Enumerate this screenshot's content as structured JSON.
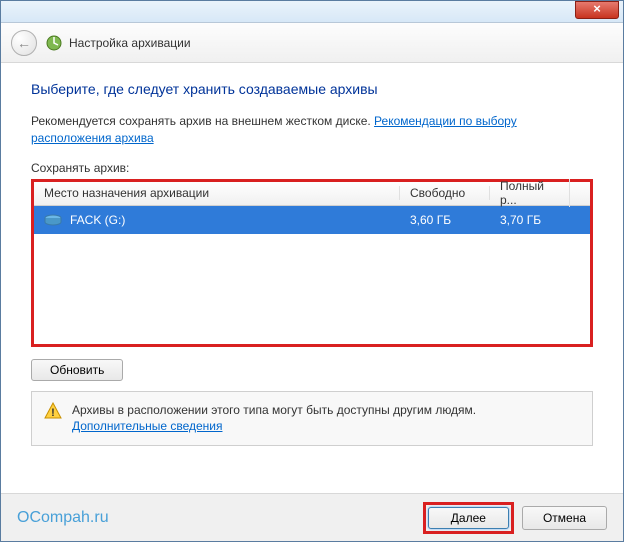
{
  "titlebar": {
    "close_glyph": "×"
  },
  "header": {
    "back_glyph": "←",
    "title": "Настройка архивации"
  },
  "content": {
    "heading": "Выберите, где следует хранить создаваемые архивы",
    "desc_prefix": "Рекомендуется сохранять архив на внешнем жестком диске. ",
    "desc_link": "Рекомендации по выбору расположения архива",
    "save_label": "Сохранять архив:",
    "columns": {
      "dest": "Место назначения архивации",
      "free": "Свободно",
      "total": "Полный р..."
    },
    "rows": [
      {
        "name": "FACK (G:)",
        "free": "3,60 ГБ",
        "total": "3,70 ГБ"
      }
    ],
    "refresh": "Обновить",
    "warning_text": "Архивы в расположении этого типа могут быть доступны другим людям.",
    "warning_link": "Дополнительные сведения"
  },
  "footer": {
    "watermark": "OCompah.ru",
    "next": "Далее",
    "cancel": "Отмена"
  }
}
